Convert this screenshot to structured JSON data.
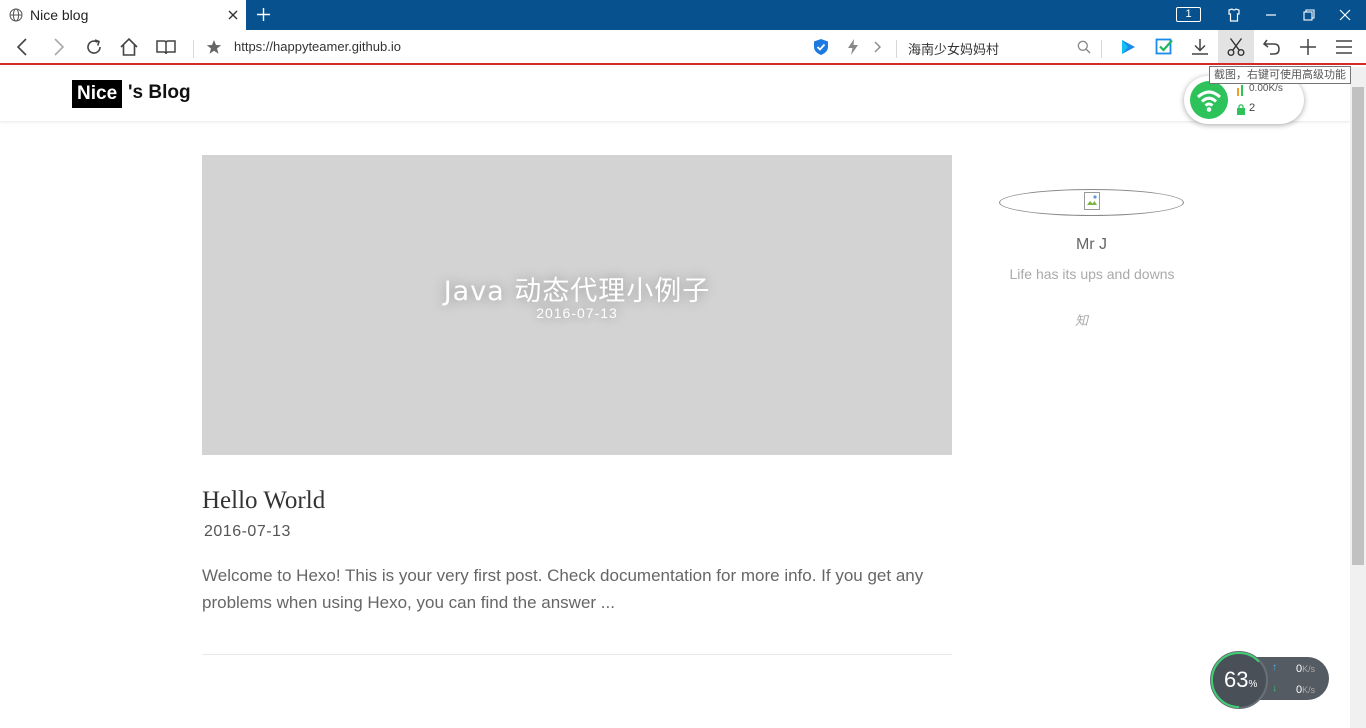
{
  "browser": {
    "tab_title": "Nice blog",
    "tab_count": "1",
    "url": "https://happyteamer.github.io",
    "search_text": "海南少女妈妈村",
    "tooltip": "截图，右键可使用高级功能",
    "accent_color": "#06518e",
    "url_underline_color": "#d42a2a"
  },
  "network_widget": {
    "speed": "0.00K/s",
    "devices": "2"
  },
  "blog": {
    "logo_box": "Nice",
    "logo_rest": "'s Blog",
    "hero": {
      "title": "Java 动态代理小例子",
      "date": "2016-07-13"
    },
    "post": {
      "title": "Hello World",
      "date": "2016-07-13",
      "excerpt": "Welcome to Hexo! This is your very first post. Check documentation for more info. If you get any problems when using Hexo, you can find the answer ..."
    },
    "sidebar": {
      "name": "Mr J",
      "bio": "Life has its ups and downs",
      "icon_text": "知"
    }
  },
  "speed_meter": {
    "percent": "63",
    "percent_unit": "%",
    "up": "0",
    "down": "0",
    "unit": "K/s"
  }
}
